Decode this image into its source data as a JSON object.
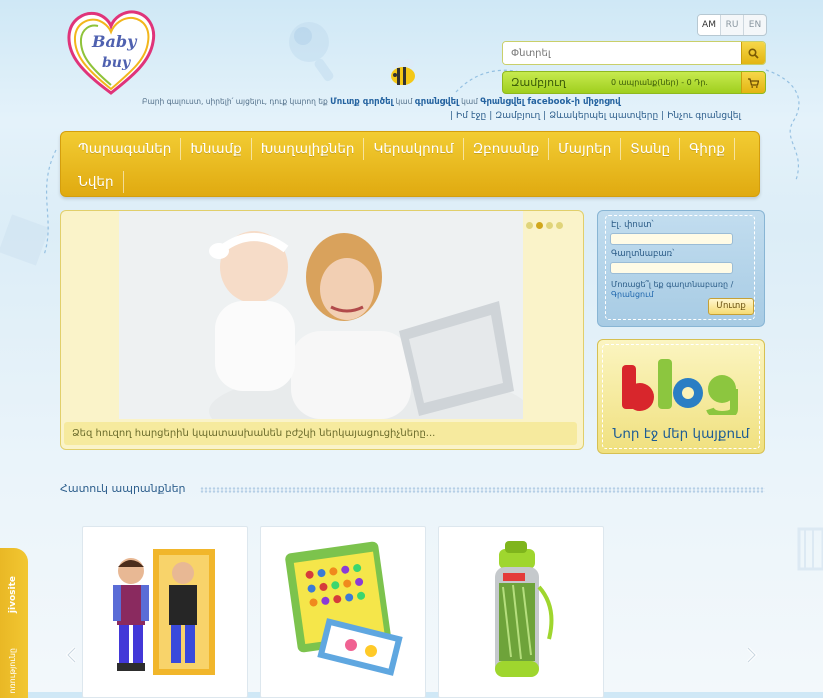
{
  "langs": [
    "AM",
    "RU",
    "EN"
  ],
  "search": {
    "placeholder": "Փնտրել"
  },
  "cart": {
    "title": "Զամբյուղ",
    "info": "0   ապրանք(ներ) -     0 Դր."
  },
  "welcome": {
    "text": "Բարի գալուստ, սիրելի՛ այցելու, դուք կարող եք",
    "login": "Մուտք գործել",
    "or1": "կամ",
    "register": "գրանցվել",
    "or2": "կամ",
    "facebook": "Գրանցվել facebook-ի միջոցով"
  },
  "toplinks": [
    "Իմ էջը",
    "Զամբյուղ",
    "Ձևակերպել պատվերը",
    "Ինչու գրանցվել"
  ],
  "nav": [
    "Պարագաներ",
    "Խնամք",
    "Խաղալիքներ",
    "Կերակրում",
    "Զբոսանք",
    "Մայրեր",
    "Տանը",
    "Գիրք",
    "Նվեր"
  ],
  "slider": {
    "caption": "Ձեզ հուզող հարցերին կպատասխանեն բժշկի ներկայացուցիչները..."
  },
  "login": {
    "email_label": "Էլ. փոստ՝",
    "password_label": "Գաղտնաբառ՝",
    "forgot": "Մոռացե՞լ եք գաղտնաբառը",
    "sep": "/",
    "register": "Գրանցում",
    "button": "Մուտք"
  },
  "blog": {
    "text": "Նոր էջ մեր կայքում"
  },
  "products": {
    "title": "Հատուկ ապրանքներ"
  },
  "jivosite": {
    "brand": "jivosite",
    "text": "ոռությունը"
  },
  "colors": {
    "nav": "#e8b81a",
    "cart": "#aed935",
    "link": "#2d5e8c"
  }
}
